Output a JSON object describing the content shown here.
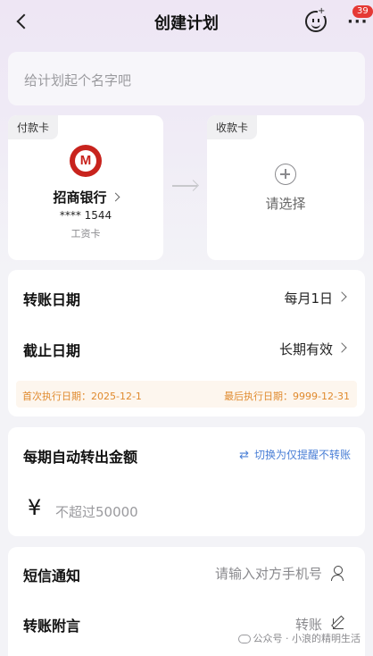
{
  "header": {
    "title": "创建计划",
    "more_badge": "39"
  },
  "plan_name": {
    "placeholder": "给计划起个名字吧"
  },
  "pay_card": {
    "tag": "付款卡",
    "bank_name": "招商银行",
    "card_number": "**** 1544",
    "card_type": "工资卡"
  },
  "receive_card": {
    "tag": "收款卡",
    "prompt": "请选择"
  },
  "dates": {
    "transfer_label": "转账日期",
    "transfer_value": "每月1日",
    "end_label": "截止日期",
    "end_value": "长期有效",
    "first_exec": "首次执行日期：2025-12-1",
    "last_exec": "最后执行日期：9999-12-31"
  },
  "amount": {
    "label": "每期自动转出金额",
    "switch_link": "切换为仅提醒不转账",
    "currency": "¥",
    "placeholder": "不超过50000"
  },
  "sms": {
    "label": "短信通知",
    "phone_placeholder": "请输入对方手机号",
    "note_label": "转账附言",
    "note_value": "转账"
  },
  "watermark": "公众号 · 小浪的精明生活",
  "colors": {
    "accent_link": "#4a7fd6",
    "exec_text": "#e08a2e",
    "bank_red": "#c8231d"
  }
}
